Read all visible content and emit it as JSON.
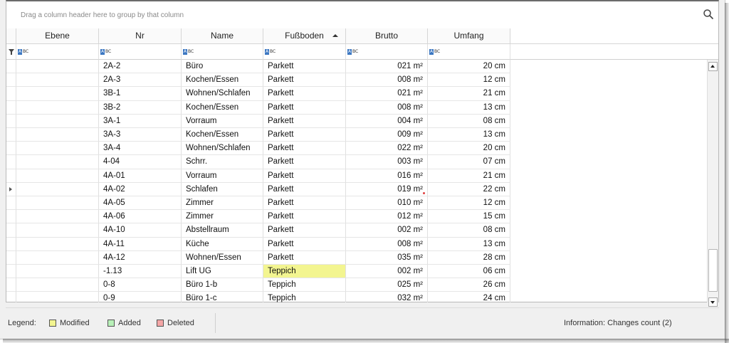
{
  "grid": {
    "group_hint": "Drag a column header here to group by that column",
    "search_icon": "search-icon",
    "columns": [
      {
        "label": "Ebene"
      },
      {
        "label": "Nr"
      },
      {
        "label": "Name"
      },
      {
        "label": "Fußboden",
        "sort": "ascending"
      },
      {
        "label": "Brutto"
      },
      {
        "label": "Umfang"
      }
    ],
    "filter_icon": "filter-icon",
    "filter_type_label": "ABC",
    "rows": [
      {
        "ebene": "",
        "nr": "2A-2",
        "name": "Büro",
        "boden": "Parkett",
        "brutto": "021 m²",
        "umfang": "20 cm"
      },
      {
        "ebene": "",
        "nr": "2A-3",
        "name": "Kochen/Essen",
        "boden": "Parkett",
        "brutto": "008 m²",
        "umfang": "12 cm"
      },
      {
        "ebene": "",
        "nr": "3B-1",
        "name": "Wohnen/Schlafen",
        "boden": "Parkett",
        "brutto": "021 m²",
        "umfang": "21 cm"
      },
      {
        "ebene": "",
        "nr": "3B-2",
        "name": "Kochen/Essen",
        "boden": "Parkett",
        "brutto": "008 m²",
        "umfang": "13 cm"
      },
      {
        "ebene": "",
        "nr": "3A-1",
        "name": "Vorraum",
        "boden": "Parkett",
        "brutto": "004 m²",
        "umfang": "08 cm"
      },
      {
        "ebene": "",
        "nr": "3A-3",
        "name": "Kochen/Essen",
        "boden": "Parkett",
        "brutto": "009 m²",
        "umfang": "13 cm"
      },
      {
        "ebene": "",
        "nr": "3A-4",
        "name": "Wohnen/Schlafen",
        "boden": "Parkett",
        "brutto": "022 m²",
        "umfang": "20 cm"
      },
      {
        "ebene": "",
        "nr": "4-04",
        "name": "Schrr.",
        "boden": "Parkett",
        "brutto": "003 m²",
        "umfang": "07 cm"
      },
      {
        "ebene": "",
        "nr": "4A-01",
        "name": "Vorraum",
        "boden": "Parkett",
        "brutto": "016 m²",
        "umfang": "21 cm"
      },
      {
        "ebene": "",
        "nr": "4A-02",
        "name": "Schlafen",
        "boden": "Parkett",
        "brutto": "019 m²",
        "umfang": "22 cm",
        "current": true,
        "marker": "red"
      },
      {
        "ebene": "",
        "nr": "4A-05",
        "name": "Zimmer",
        "boden": "Parkett",
        "brutto": "010 m²",
        "umfang": "12 cm"
      },
      {
        "ebene": "",
        "nr": "4A-06",
        "name": "Zimmer",
        "boden": "Parkett",
        "brutto": "012 m²",
        "umfang": "15 cm"
      },
      {
        "ebene": "",
        "nr": "4A-10",
        "name": "Abstellraum",
        "boden": "Parkett",
        "brutto": "002 m²",
        "umfang": "08 cm"
      },
      {
        "ebene": "",
        "nr": "4A-11",
        "name": "Küche",
        "boden": "Parkett",
        "brutto": "008 m²",
        "umfang": "13 cm"
      },
      {
        "ebene": "",
        "nr": "4A-12",
        "name": "Wohnen/Essen",
        "boden": "Parkett",
        "brutto": "035 m²",
        "umfang": "28 cm"
      },
      {
        "ebene": "",
        "nr": "-1.13",
        "name": "Lift UG",
        "boden": "Teppich",
        "brutto": "002 m²",
        "umfang": "06 cm",
        "modified_col": "boden"
      },
      {
        "ebene": "",
        "nr": "0-8",
        "name": "Büro 1-b",
        "boden": "Teppich",
        "brutto": "025 m²",
        "umfang": "26 cm"
      },
      {
        "ebene": "",
        "nr": "0-9",
        "name": "Büro 1-c",
        "boden": "Teppich",
        "brutto": "032 m²",
        "umfang": "24 cm"
      }
    ]
  },
  "legend": {
    "label": "Legend:",
    "items": [
      {
        "label": "Modified",
        "color": "#f3f590"
      },
      {
        "label": "Added",
        "color": "#b8f0b8"
      },
      {
        "label": "Deleted",
        "color": "#f4a6a6"
      }
    ]
  },
  "info": {
    "text": "Information:  Changes count  (2)"
  },
  "colors": {
    "modified": "#f3f590",
    "grid_line": "#e0e0e0",
    "abc_badge": "#3d78c2"
  }
}
